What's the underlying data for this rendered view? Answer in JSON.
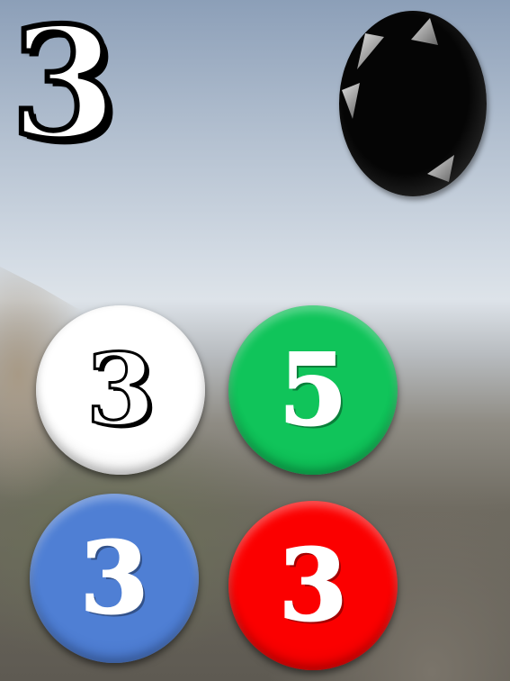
{
  "target": {
    "digit": "3",
    "icon": "ornate-digit"
  },
  "gem": {
    "icon": "black-gem-icon",
    "color": "#050505"
  },
  "balls": [
    {
      "label": "3",
      "color": "#ffffff"
    },
    {
      "label": "5",
      "color": "#10c45a"
    },
    {
      "label": "3",
      "color": "#4f7fd4"
    },
    {
      "label": "3",
      "color": "#fb0000"
    }
  ]
}
